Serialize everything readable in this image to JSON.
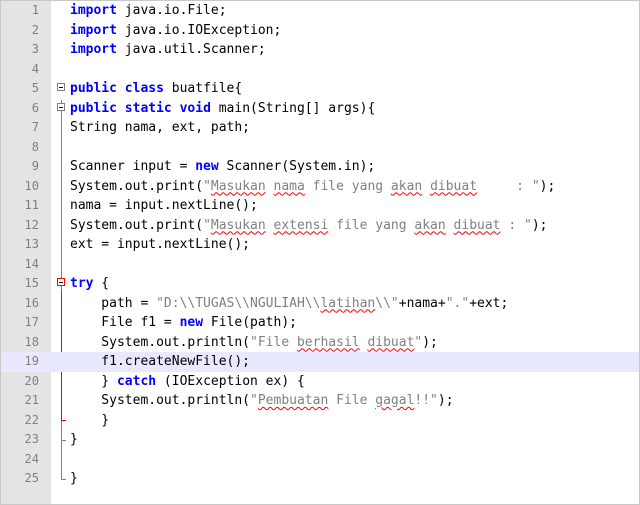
{
  "editor": {
    "line_numbers": [
      "1",
      "2",
      "3",
      "4",
      "5",
      "6",
      "7",
      "8",
      "9",
      "10",
      "11",
      "12",
      "13",
      "14",
      "15",
      "16",
      "17",
      "18",
      "19",
      "20",
      "21",
      "22",
      "23",
      "24",
      "25"
    ],
    "current_line": 19,
    "lines": {
      "l1": {
        "kw": "import",
        "rest": " java.io.File;"
      },
      "l2": {
        "kw": "import",
        "rest": " java.io.IOException;"
      },
      "l3": {
        "kw": "import",
        "rest": " java.util.Scanner;"
      },
      "l5": {
        "kw1": "public",
        "kw2": "class",
        "rest": " buatfile{"
      },
      "l6": {
        "kw1": "public",
        "kw2": "static",
        "kw3": "void",
        "rest": " main(String[] args){"
      },
      "l7": {
        "text": "String nama, ext, path;"
      },
      "l9": {
        "pre": "Scanner input = ",
        "kw": "new",
        "post": " Scanner(System.in);"
      },
      "l10": {
        "pre": "System.out.print(",
        "str_open": "\"",
        "w1": "Masukan",
        "s1": " ",
        "w2": "nama",
        "s2": " file yang ",
        "w3": "akan",
        "s3": " ",
        "w4": "dibuat",
        "str_close": "     : \"",
        "post": ");"
      },
      "l11": {
        "text": "nama = input.nextLine();"
      },
      "l12": {
        "pre": "System.out.print(",
        "str_open": "\"",
        "w1": "Masukan",
        "s1": " ",
        "w2": "extensi",
        "s2": " file yang ",
        "w3": "akan",
        "s3": " ",
        "w4": "dibuat",
        "str_close": " : \"",
        "post": ");"
      },
      "l13": {
        "text": "ext = input.nextLine();"
      },
      "l15": {
        "kw": "try",
        "rest": " {"
      },
      "l16": {
        "pre": "    path = ",
        "str_a": "\"D:\\\\TUGAS\\\\NGULIAH\\\\",
        "w1": "latihan",
        "str_b": "\\\\\"",
        "mid": "+nama+",
        "str_c": "\".\"",
        "post": "+ext;"
      },
      "l17": {
        "pre": "    File f1 = ",
        "kw": "new",
        "post": " File(path);"
      },
      "l18": {
        "pre": "    System.out.println(",
        "str_a": "\"File ",
        "w1": "berhasil",
        "s1": " ",
        "w2": "dibuat",
        "str_b": "\"",
        "post": ");"
      },
      "l19": {
        "text": "    f1.createNewFile();"
      },
      "l20": {
        "pre": "    } ",
        "kw": "catch",
        "post": " (IOException ex) {"
      },
      "l21": {
        "pre": "    System.out.println(",
        "str_a": "\"",
        "w1": "Pembuatan",
        "s1": " File ",
        "w2": "gagal",
        "str_b": "!!\"",
        "post": ");"
      },
      "l22": {
        "text": "    }"
      },
      "l23": {
        "text": "}"
      },
      "l25": {
        "text": "}"
      }
    }
  },
  "colors": {
    "keyword": "#0000ff",
    "string": "#808080",
    "gutter": "#e4e4e4",
    "current_line": "#e8e8ff",
    "spell_underline": "#ff0000",
    "try_fold": "#ff0000"
  }
}
